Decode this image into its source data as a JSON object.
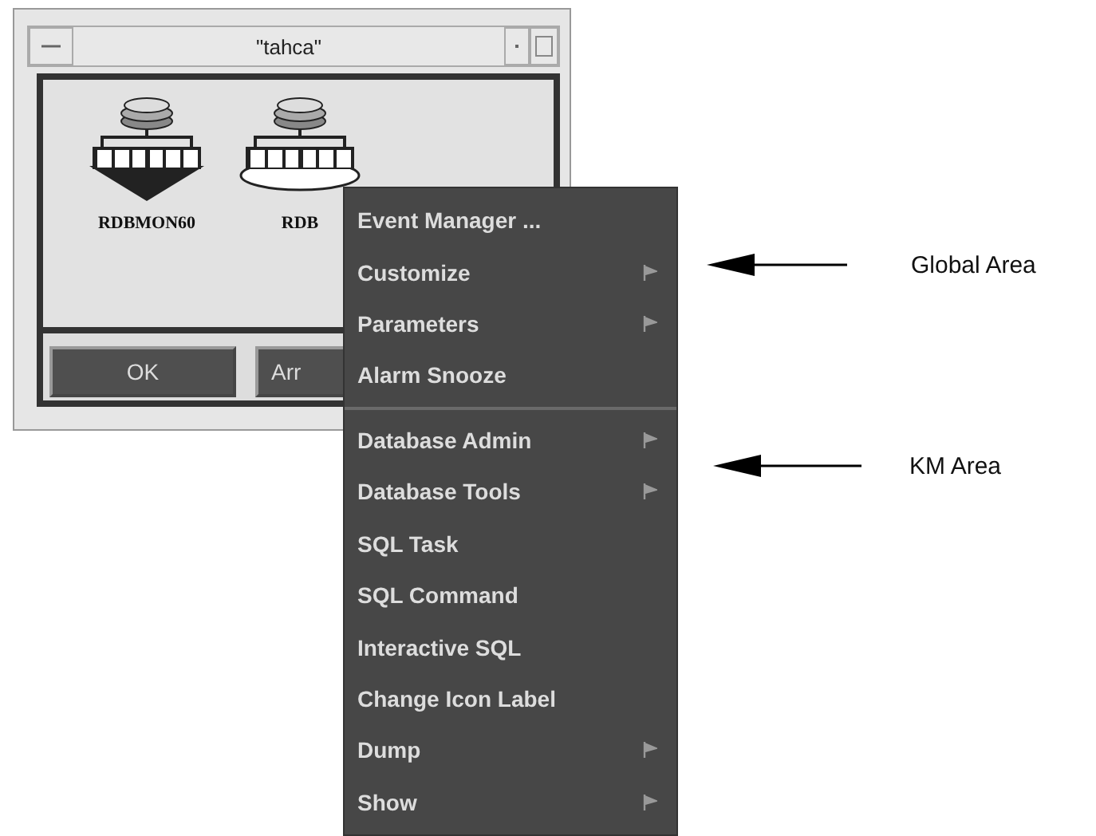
{
  "window": {
    "title": "\"tahca\"",
    "icons": [
      {
        "label": "RDBMON60",
        "kind": "dark"
      },
      {
        "label": "RDB",
        "kind": "light"
      }
    ],
    "buttons": [
      "OK",
      "Arr"
    ]
  },
  "menu": {
    "items": [
      {
        "label": "Event Manager ...",
        "kind": "item"
      },
      {
        "label": "Customize",
        "kind": "submenu"
      },
      {
        "label": "Parameters",
        "kind": "submenu"
      },
      {
        "label": "Alarm Snooze",
        "kind": "item"
      },
      {
        "kind": "separator"
      },
      {
        "label": "Database Admin",
        "kind": "submenu"
      },
      {
        "label": "Database Tools",
        "kind": "submenu"
      },
      {
        "label": "SQL Task",
        "kind": "item"
      },
      {
        "label": "SQL Command",
        "kind": "item"
      },
      {
        "label": "Interactive SQL",
        "kind": "item"
      },
      {
        "label": "Change Icon Label",
        "kind": "item"
      },
      {
        "label": "Dump",
        "kind": "submenu"
      },
      {
        "label": "Show",
        "kind": "submenu"
      }
    ]
  },
  "callouts": [
    {
      "label": "Global Area"
    },
    {
      "label": "KM Area"
    }
  ]
}
